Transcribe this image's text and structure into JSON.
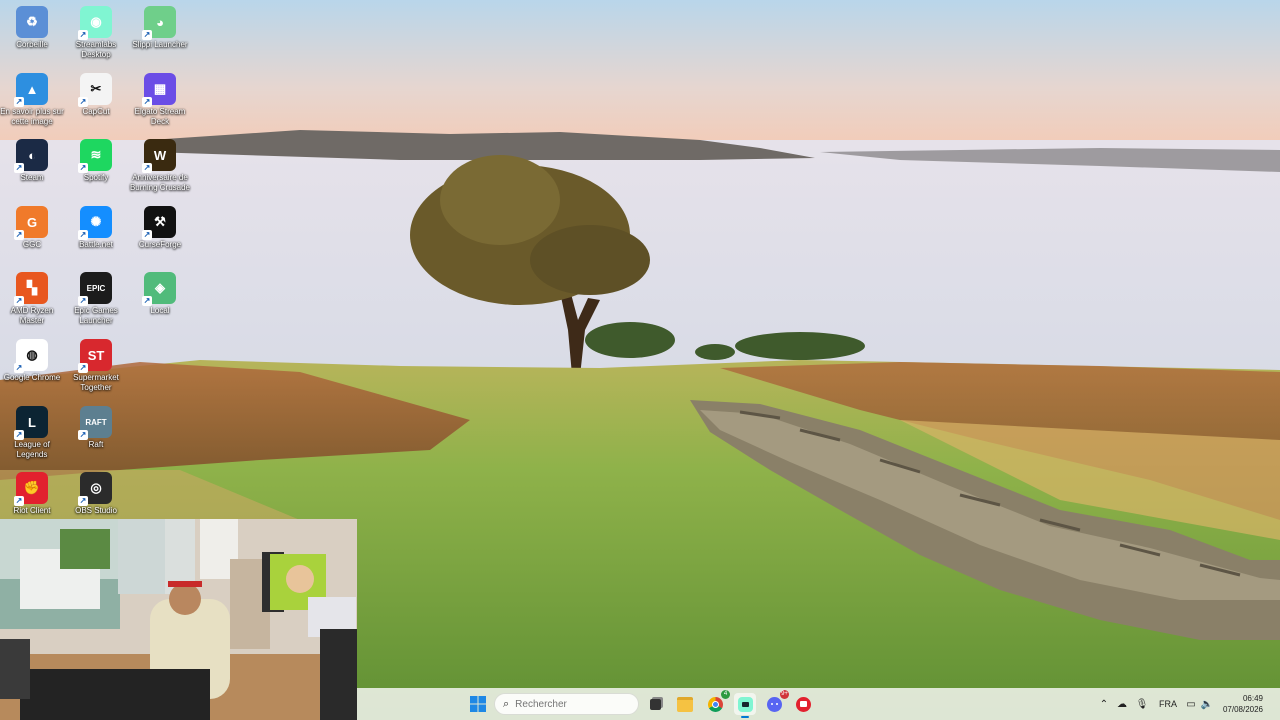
{
  "desktop": {
    "icons": [
      {
        "label": "Corbeille",
        "icon": "recycle-bin-icon",
        "color": "#5b8fd6",
        "glyph": "♻"
      },
      {
        "label": "Streamlabs Desktop",
        "icon": "streamlabs-icon",
        "color": "#80f5d2",
        "glyph": "◉"
      },
      {
        "label": "Slippi Launcher",
        "icon": "slippi-icon",
        "color": "#6fcf8a",
        "glyph": "◕"
      },
      {
        "label": "En savoir plus sur cette image",
        "icon": "info-image-icon",
        "color": "#2d8fe0",
        "glyph": "▲"
      },
      {
        "label": "CapCut",
        "icon": "capcut-icon",
        "color": "#f4f4f4",
        "glyph": "✂"
      },
      {
        "label": "Elgato Stream Deck",
        "icon": "elgato-stream-deck-icon",
        "color": "#6b4de6",
        "glyph": "▦"
      },
      {
        "label": "Steam",
        "icon": "steam-icon",
        "color": "#1b2a45",
        "glyph": "◐"
      },
      {
        "label": "Spotify",
        "icon": "spotify-icon",
        "color": "#1ed760",
        "glyph": "≋"
      },
      {
        "label": "Anniversaire de Burning Crusade",
        "icon": "wow-icon",
        "color": "#3a2a10",
        "glyph": "W"
      },
      {
        "label": "GGC",
        "icon": "ggc-icon",
        "color": "#f07a2a",
        "glyph": "G"
      },
      {
        "label": "Battle.net",
        "icon": "battlenet-icon",
        "color": "#148eff",
        "glyph": "✺"
      },
      {
        "label": "CurseForge",
        "icon": "curseforge-icon",
        "color": "#111111",
        "glyph": "⚒"
      },
      {
        "label": "AMD Ryzen Master",
        "icon": "amd-ryzen-icon",
        "color": "#e8571f",
        "glyph": "▚"
      },
      {
        "label": "Epic Games Launcher",
        "icon": "epic-games-icon",
        "color": "#1c1c1c",
        "glyph": "EPIC"
      },
      {
        "label": "Local",
        "icon": "local-icon",
        "color": "#51bb7b",
        "glyph": "◈"
      },
      {
        "label": "Google Chrome",
        "icon": "chrome-icon",
        "color": "#ffffff",
        "glyph": "◍"
      },
      {
        "label": "Supermarket Together",
        "icon": "supermarket-together-icon",
        "color": "#d8282e",
        "glyph": "ST"
      },
      {
        "label": "League of Legends",
        "icon": "league-of-legends-icon",
        "color": "#0c2433",
        "glyph": "L"
      },
      {
        "label": "Raft",
        "icon": "raft-icon",
        "color": "#5d7f90",
        "glyph": "RAFT"
      },
      {
        "label": "Riot Client",
        "icon": "riot-client-icon",
        "color": "#e2212e",
        "glyph": "✊"
      },
      {
        "label": "OBS Studio",
        "icon": "obs-studio-icon",
        "color": "#2b2b2b",
        "glyph": "◎"
      }
    ]
  },
  "taskbar": {
    "search_placeholder": "Rechercher",
    "apps": [
      {
        "name": "start-button",
        "icon": "windows-start-icon"
      },
      {
        "name": "task-view-button",
        "icon": "task-view-icon"
      },
      {
        "name": "file-explorer-button",
        "icon": "folder-icon"
      },
      {
        "name": "chrome-taskbar-button",
        "icon": "chrome-icon",
        "badge": "4"
      },
      {
        "name": "streamlabs-taskbar-button",
        "icon": "streamlabs-icon"
      },
      {
        "name": "discord-taskbar-button",
        "icon": "discord-icon",
        "badge": "9+"
      },
      {
        "name": "riot-taskbar-button",
        "icon": "riot-client-icon"
      }
    ],
    "tray": {
      "language": "FRA",
      "time": "06:49",
      "date": "07/08/2026"
    }
  },
  "colors": {
    "taskbar_bg": "#e8eee2",
    "accent": "#0078d4",
    "discord": "#5865f2",
    "badge_green": "#2e9b3f",
    "badge_red": "#d13438"
  }
}
